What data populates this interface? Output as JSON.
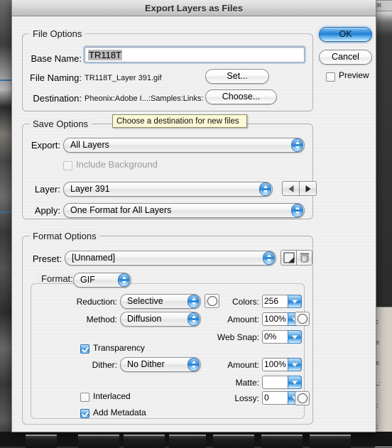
{
  "window": {
    "title": "Export Layers as Files"
  },
  "actions": {
    "ok_label": "OK",
    "cancel_label": "Cancel",
    "preview_label": "Preview",
    "preview_checked": false
  },
  "file_options": {
    "group_title": "File Options",
    "base_name_label": "Base Name:",
    "base_name_value": "TR118T",
    "file_naming_label": "File Naming:",
    "file_naming_value": "TR118T_Layer 391.gif",
    "set_button_label": "Set...",
    "destination_label": "Destination:",
    "destination_value": "Pheonix:Adobe I...:Samples:Links:",
    "choose_button_label": "Choose..."
  },
  "tooltip": {
    "text": "Choose a destination for new files"
  },
  "save_options": {
    "group_title": "Save Options",
    "export_label": "Export:",
    "export_value": "All Layers",
    "include_background_label": "Include Background",
    "include_background_checked": false,
    "include_background_enabled": false,
    "layer_label": "Layer:",
    "layer_value": "Layer 391",
    "prev_layer_icon": "triangle-left-icon",
    "next_layer_icon": "triangle-right-icon",
    "apply_label": "Apply:",
    "apply_value": "One Format for All Layers"
  },
  "format_options": {
    "group_title": "Format Options",
    "preset_label": "Preset:",
    "preset_value": "[Unnamed]",
    "save_preset_icon": "save-preset-icon",
    "delete_preset_icon": "trash-icon",
    "format_label": "Format:",
    "format_value": "GIF",
    "reduction_label": "Reduction:",
    "reduction_value": "Selective",
    "reduction_option_icon": "circle-option-icon",
    "colors_label": "Colors:",
    "colors_value": "256",
    "method_label": "Method:",
    "method_value": "Diffusion",
    "amount_label": "Amount:",
    "amount_value": "100%",
    "amount_option_icon": "circle-option-icon",
    "websnap_label": "Web Snap:",
    "websnap_value": "0%",
    "transparency_label": "Transparency",
    "transparency_checked": true,
    "dither_label": "Dither:",
    "dither_value": "No Dither",
    "dither_amount_label": "Amount:",
    "dither_amount_value": "100%",
    "matte_label": "Matte:",
    "matte_value": "",
    "interlaced_label": "Interlaced",
    "interlaced_checked": false,
    "lossy_label": "Lossy:",
    "lossy_value": "0",
    "lossy_option_icon": "circle-option-icon",
    "add_metadata_label": "Add Metadata",
    "add_metadata_checked": true
  },
  "background": {
    "right_fragments": [
      "c",
      "e:",
      "e:",
      "L:",
      "t:",
      "t:"
    ],
    "top_right_fragment": "Edit"
  },
  "colors": {
    "dialog_bg": "#ededed",
    "accent_blue": "#1f7ed4",
    "tooltip_bg": "#fbf8d6",
    "selection_gray": "#b9b9b9"
  }
}
